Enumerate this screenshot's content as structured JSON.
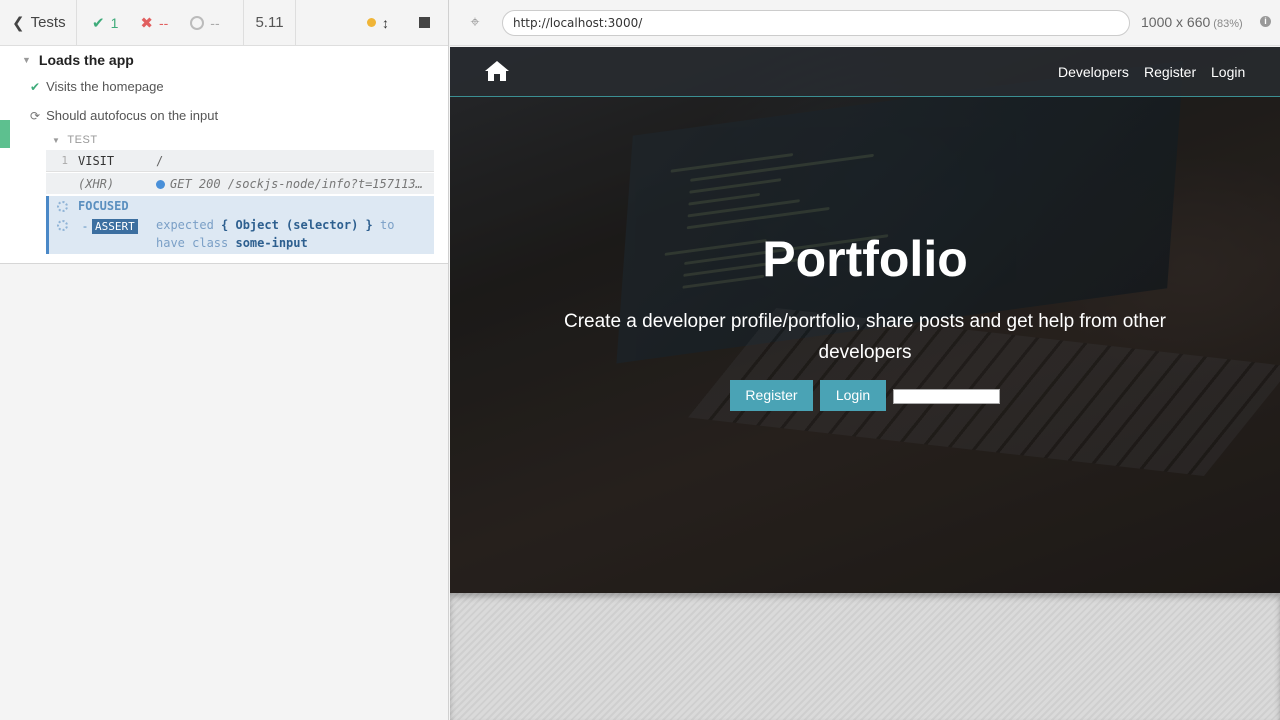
{
  "reporter": {
    "tests_label": "Tests",
    "passed": "1",
    "failed": "--",
    "pending": "--",
    "duration": "5.11"
  },
  "runnables": {
    "suite_title": "Loads the app",
    "tests": [
      {
        "title": "Visits the homepage",
        "state": "passed"
      },
      {
        "title": "Should autofocus on the input",
        "state": "running"
      }
    ],
    "test_section_label": "TEST",
    "commands": [
      {
        "number": "1",
        "name": "VISIT",
        "message": "/"
      },
      {
        "number": "",
        "name": "(XHR)",
        "message": "GET 200 /sockjs-node/info?t=1571136…"
      }
    ],
    "focused": {
      "name": "FOCUSED",
      "assert_label": "ASSERT",
      "dash": "-",
      "msg_expected": "expected",
      "msg_subject": "{ Object (selector) }",
      "msg_to": "to",
      "msg_have_class": "have class",
      "msg_class": "some-input"
    }
  },
  "aut_header": {
    "url": "http://localhost:3000/",
    "viewport": "1000 x 660",
    "scale": "(83%)"
  },
  "app": {
    "nav_links": [
      "Developers",
      "Register",
      "Login"
    ],
    "title": "Portfolio",
    "lead": "Create a developer profile/portfolio, share posts and get help from other developers",
    "register_button": "Register",
    "login_button": "Login"
  },
  "colors": {
    "pass": "#3eab7a",
    "fail": "#e15f5f",
    "accent": "#4aa3b5",
    "focused_border": "#4a88c7"
  }
}
